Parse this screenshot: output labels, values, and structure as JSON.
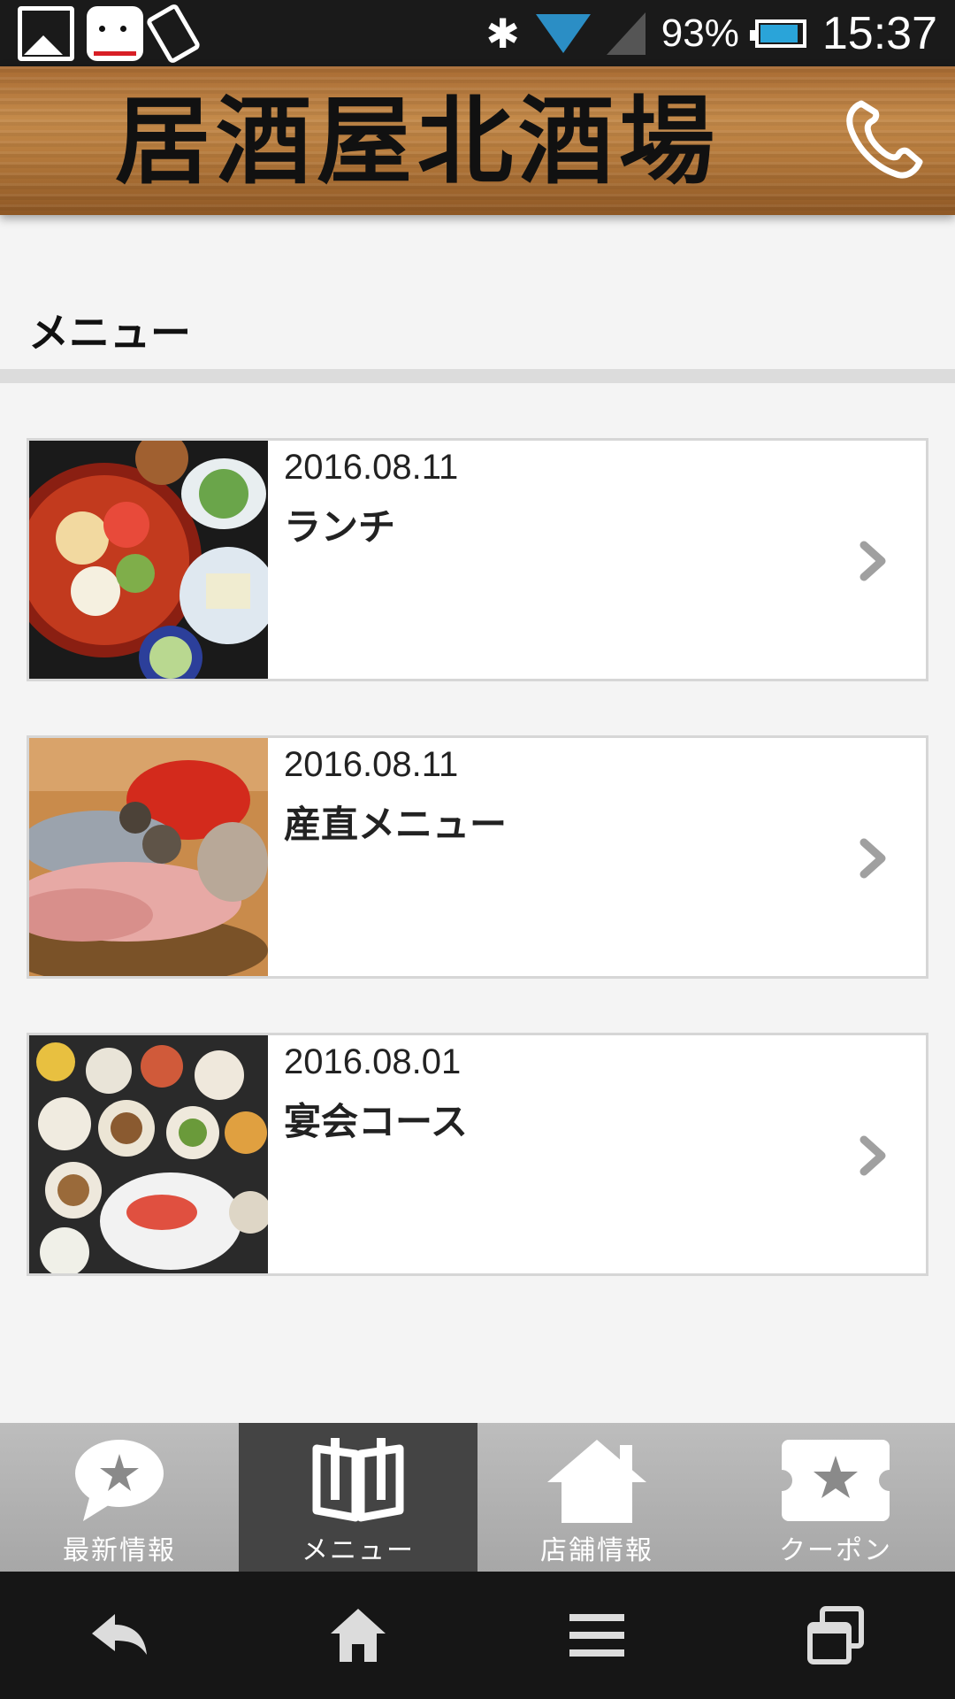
{
  "status_bar": {
    "icons": [
      "gallery-icon",
      "dog-app-icon",
      "rotate-icon",
      "bluetooth-icon",
      "wifi-icon",
      "signal-icon"
    ],
    "bluetooth_glyph": "✱",
    "battery": "93%",
    "battery_level": 0.93,
    "time": "15:37"
  },
  "header": {
    "title": "居酒屋北酒場",
    "phone_icon": "phone-icon"
  },
  "page": {
    "title": "メニュー"
  },
  "menu_items": [
    {
      "date": "2016.08.11",
      "title": "ランチ",
      "thumb": "lunch-photo"
    },
    {
      "date": "2016.08.11",
      "title": "産直メニュー",
      "thumb": "fish-photo"
    },
    {
      "date": "2016.08.01",
      "title": "宴会コース",
      "thumb": "banquet-photo"
    }
  ],
  "tabs": [
    {
      "label": "最新情報",
      "icon": "speech-star-icon",
      "active": false
    },
    {
      "label": "メニュー",
      "icon": "book-icon",
      "active": true
    },
    {
      "label": "店舗情報",
      "icon": "house-icon",
      "active": false
    },
    {
      "label": "クーポン",
      "icon": "ticket-star-icon",
      "active": false
    }
  ],
  "navbar": {
    "buttons": [
      "back-icon",
      "home-icon",
      "menu-icon",
      "recents-icon"
    ]
  },
  "colors": {
    "wood": "#b57a3c",
    "active_tab": "#444444",
    "tab_bar": "#a7a7a7"
  }
}
